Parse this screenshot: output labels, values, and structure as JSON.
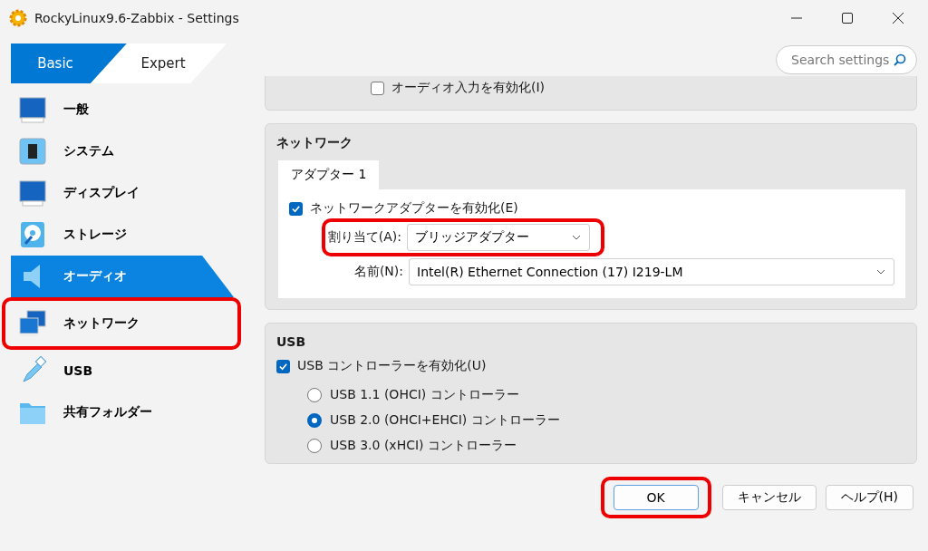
{
  "window": {
    "title": "RockyLinux9.6-Zabbix - Settings"
  },
  "mode_tabs": [
    {
      "label": "Basic",
      "selected": true
    },
    {
      "label": "Expert",
      "selected": false
    }
  ],
  "search": {
    "placeholder": "Search settings"
  },
  "sidebar": {
    "items": [
      {
        "label": "一般",
        "selected": false,
        "highlighted": false
      },
      {
        "label": "システム",
        "selected": false,
        "highlighted": false
      },
      {
        "label": "ディスプレイ",
        "selected": false,
        "highlighted": false
      },
      {
        "label": "ストレージ",
        "selected": false,
        "highlighted": false
      },
      {
        "label": "オーディオ",
        "selected": true,
        "highlighted": false
      },
      {
        "label": "ネットワーク",
        "selected": false,
        "highlighted": true
      },
      {
        "label": "USB",
        "selected": false,
        "highlighted": false
      },
      {
        "label": "共有フォルダー",
        "selected": false,
        "highlighted": false
      }
    ]
  },
  "audio": {
    "input": {
      "label": "オーディオ入力を有効化(I)",
      "checked": false
    }
  },
  "network": {
    "title": "ネットワーク",
    "tabs": [
      {
        "label": "アダプター 1",
        "selected": true
      }
    ],
    "enable": {
      "label": "ネットワークアダプターを有効化(E)",
      "checked": true
    },
    "attached_to": {
      "label": "割り当て(A):",
      "value": "ブリッジアダプター",
      "highlighted": true
    },
    "name": {
      "label": "名前(N):",
      "value": "Intel(R) Ethernet Connection (17) I219-LM"
    }
  },
  "usb": {
    "title": "USB",
    "enable": {
      "label": "USB コントローラーを有効化(U)",
      "checked": true
    },
    "controllers": [
      {
        "label": "USB 1.1 (OHCI) コントローラー",
        "selected": false
      },
      {
        "label": "USB 2.0 (OHCI+EHCI) コントローラー",
        "selected": true
      },
      {
        "label": "USB 3.0 (xHCI) コントローラー",
        "selected": false
      }
    ]
  },
  "buttons": [
    {
      "label": "OK",
      "default": true,
      "highlighted": true
    },
    {
      "label": "キャンセル",
      "default": false,
      "highlighted": false
    },
    {
      "label": "ヘルプ(H)",
      "default": false,
      "highlighted": false
    }
  ]
}
